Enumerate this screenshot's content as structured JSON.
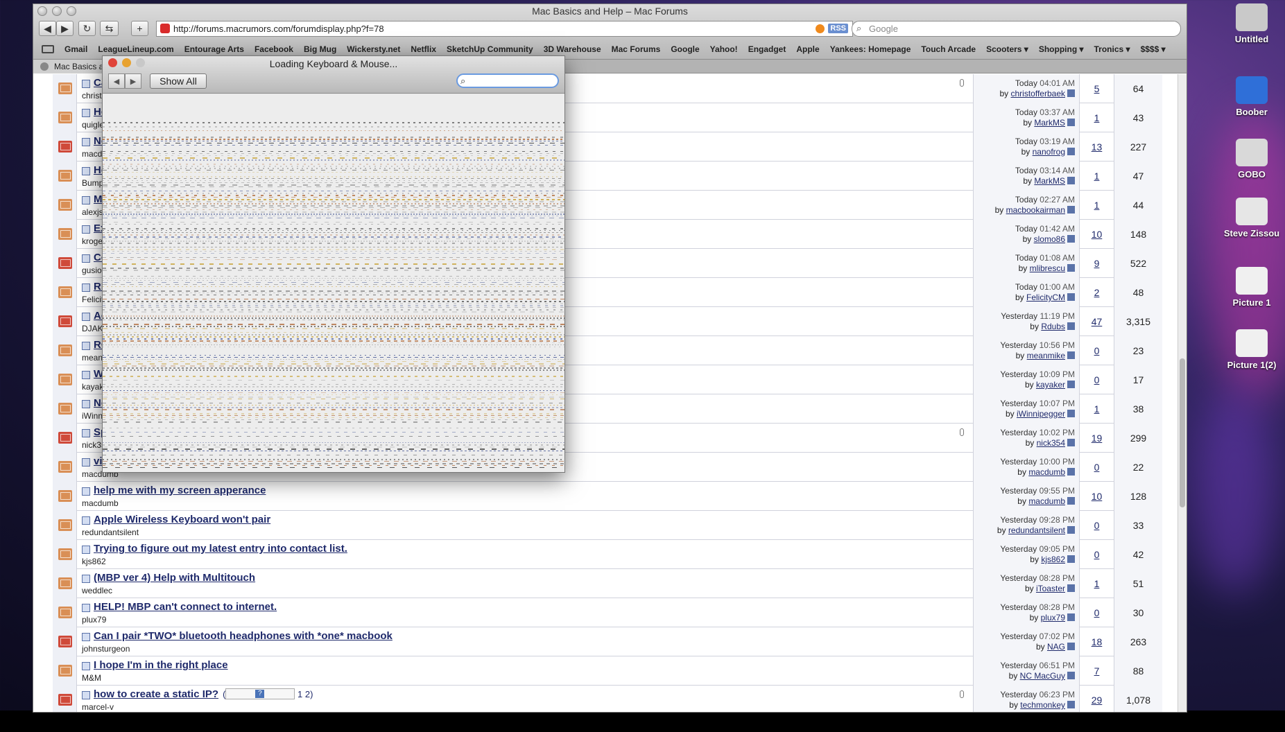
{
  "window": {
    "title": "Mac Basics and Help – Mac Forums",
    "url": "http://forums.macrumors.com/forumdisplay.php?f=78",
    "rss_label": "RSS",
    "search_placeholder": "Google"
  },
  "bookmarks": [
    "Gmail",
    "LeagueLineup.com",
    "Entourage Arts",
    "Facebook",
    "Big Mug",
    "Wickersty.net",
    "Netflix",
    "SketchUp Community",
    "3D Warehouse",
    "Mac Forums",
    "Google",
    "Yahoo!",
    "Engadget",
    "Apple",
    "Yankees: Homepage",
    "Touch Arcade",
    "Scooters ▾",
    "Shopping ▾",
    "Tronics ▾",
    "$$$$ ▾"
  ],
  "tab": {
    "label": "Mac Basics a"
  },
  "prefs": {
    "title": "Loading Keyboard & Mouse...",
    "show_all": "Show All",
    "back": "◀",
    "forward": "▶"
  },
  "threads": [
    {
      "title": "Ca",
      "author": "christo",
      "date": "Today",
      "time": "04:01 AM",
      "by": "christofferbaek",
      "replies": "5",
      "views": "64",
      "hot": false,
      "clip": true
    },
    {
      "title": "Ho",
      "author": "quigle",
      "date": "Today",
      "time": "03:37 AM",
      "by": "MarkMS",
      "replies": "1",
      "views": "43",
      "hot": false,
      "clip": false
    },
    {
      "title": "Ne",
      "author": "macdu",
      "date": "Today",
      "time": "03:19 AM",
      "by": "nanofrog",
      "replies": "13",
      "views": "227",
      "hot": true,
      "clip": false
    },
    {
      "title": "He",
      "author": "Bump",
      "date": "Today",
      "time": "03:14 AM",
      "by": "MarkMS",
      "replies": "1",
      "views": "47",
      "hot": false,
      "clip": false
    },
    {
      "title": "Ma",
      "author": "alexjs",
      "date": "Today",
      "time": "02:27 AM",
      "by": "macbookairman",
      "replies": "1",
      "views": "44",
      "hot": false,
      "clip": false
    },
    {
      "title": "Ex",
      "author": "kroge",
      "date": "Today",
      "time": "01:42 AM",
      "by": "slomo86",
      "replies": "10",
      "views": "148",
      "hot": false,
      "clip": false
    },
    {
      "title": "Co",
      "author": "gusiou",
      "date": "Today",
      "time": "01:08 AM",
      "by": "mlibrescu",
      "replies": "9",
      "views": "522",
      "hot": true,
      "clip": false
    },
    {
      "title": "RF",
      "author": "Felicit",
      "date": "Today",
      "time": "01:00 AM",
      "by": "FelicityCM",
      "replies": "2",
      "views": "48",
      "hot": false,
      "clip": false
    },
    {
      "title": "Ac",
      "author": "DJAKO",
      "date": "Yesterday",
      "time": "11:19 PM",
      "by": "Rdubs",
      "replies": "47",
      "views": "3,315",
      "hot": true,
      "clip": false
    },
    {
      "title": "RO",
      "author": "meani",
      "date": "Yesterday",
      "time": "10:56 PM",
      "by": "meanmike",
      "replies": "0",
      "views": "23",
      "hot": false,
      "clip": false
    },
    {
      "title": "Wi",
      "author": "kayak",
      "date": "Yesterday",
      "time": "10:09 PM",
      "by": "kayaker",
      "replies": "0",
      "views": "17",
      "hot": false,
      "clip": false
    },
    {
      "title": "Ne",
      "author": "iWinni",
      "date": "Yesterday",
      "time": "10:07 PM",
      "by": "iWinnipegger",
      "replies": "1",
      "views": "38",
      "hot": false,
      "clip": false
    },
    {
      "title": "Sp",
      "author": "nick35",
      "date": "Yesterday",
      "time": "10:02 PM",
      "by": "nick354",
      "replies": "19",
      "views": "299",
      "hot": true,
      "clip": true
    },
    {
      "title": "vid",
      "author": "macdumb",
      "date": "Yesterday",
      "time": "10:00 PM",
      "by": "macdumb",
      "replies": "0",
      "views": "22",
      "hot": false,
      "clip": false
    },
    {
      "title": "help me with my screen apperance",
      "author": "macdumb",
      "date": "Yesterday",
      "time": "09:55 PM",
      "by": "macdumb",
      "replies": "10",
      "views": "128",
      "hot": false,
      "clip": false
    },
    {
      "title": "Apple Wireless Keyboard won't pair",
      "author": "redundantsilent",
      "date": "Yesterday",
      "time": "09:28 PM",
      "by": "redundantsilent",
      "replies": "0",
      "views": "33",
      "hot": false,
      "clip": false
    },
    {
      "title": "Trying to figure out my latest entry into contact list.",
      "author": "kjs862",
      "date": "Yesterday",
      "time": "09:05 PM",
      "by": "kjs862",
      "replies": "0",
      "views": "42",
      "hot": false,
      "clip": false
    },
    {
      "title": "(MBP ver 4) Help with Multitouch",
      "author": "weddlec",
      "date": "Yesterday",
      "time": "08:28 PM",
      "by": "iToaster",
      "replies": "1",
      "views": "51",
      "hot": false,
      "clip": false
    },
    {
      "title": "HELP! MBP can't connect to internet.",
      "author": "plux79",
      "date": "Yesterday",
      "time": "08:28 PM",
      "by": "plux79",
      "replies": "0",
      "views": "30",
      "hot": false,
      "clip": false
    },
    {
      "title": "Can I pair *TWO* bluetooth headphones with *one* macbook",
      "author": "johnsturgeon",
      "date": "Yesterday",
      "time": "07:02 PM",
      "by": "NAG",
      "replies": "18",
      "views": "263",
      "hot": true,
      "clip": false
    },
    {
      "title": "I hope I'm in the right place",
      "author": "M&M",
      "date": "Yesterday",
      "time": "06:51 PM",
      "by": "NC MacGuy",
      "replies": "7",
      "views": "88",
      "hot": false,
      "clip": false
    },
    {
      "title": "how to create a static IP?",
      "author": "marcel-v",
      "date": "Yesterday",
      "time": "06:23 PM",
      "by": "techmonkey",
      "replies": "29",
      "views": "1,078",
      "hot": true,
      "clip": true,
      "pages": "1 2)",
      "pager_open": "("
    }
  ],
  "desktop_icons": [
    {
      "label": "Untitled",
      "icon": "hard-drive-icon",
      "color": "#c9c9c9"
    },
    {
      "label": "Boober",
      "icon": "blue-drive-icon",
      "color": "#2f6fd8"
    },
    {
      "label": "GOBO",
      "icon": "external-drive-icon",
      "color": "#d9d9d9"
    },
    {
      "label": "Steve Zissou",
      "icon": "ipod-icon",
      "color": "#e6e6e6"
    },
    {
      "label": "Picture 1",
      "icon": "picture-file-icon",
      "color": "#f0f0f0"
    },
    {
      "label": "Picture 1(2)",
      "icon": "picture-file-icon",
      "color": "#f0f0f0"
    }
  ]
}
